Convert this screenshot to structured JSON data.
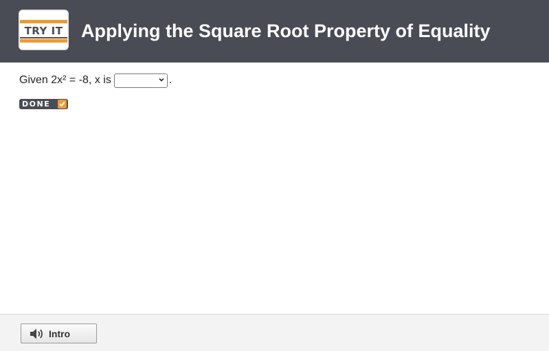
{
  "header": {
    "logo_text": "TRY IT",
    "title": "Applying the Square Root Property of Equality"
  },
  "question": {
    "prompt": "Given 2x² = -8, x is",
    "selected_value": "",
    "trailing_punctuation": "."
  },
  "done_button": {
    "label": "DONE",
    "icon": "check-icon"
  },
  "footer": {
    "intro_label": "Intro",
    "intro_icon": "speaker-icon"
  },
  "colors": {
    "header_bg": "#494c55",
    "accent": "#f09a2e",
    "footer_bg": "#f3f3f3"
  }
}
